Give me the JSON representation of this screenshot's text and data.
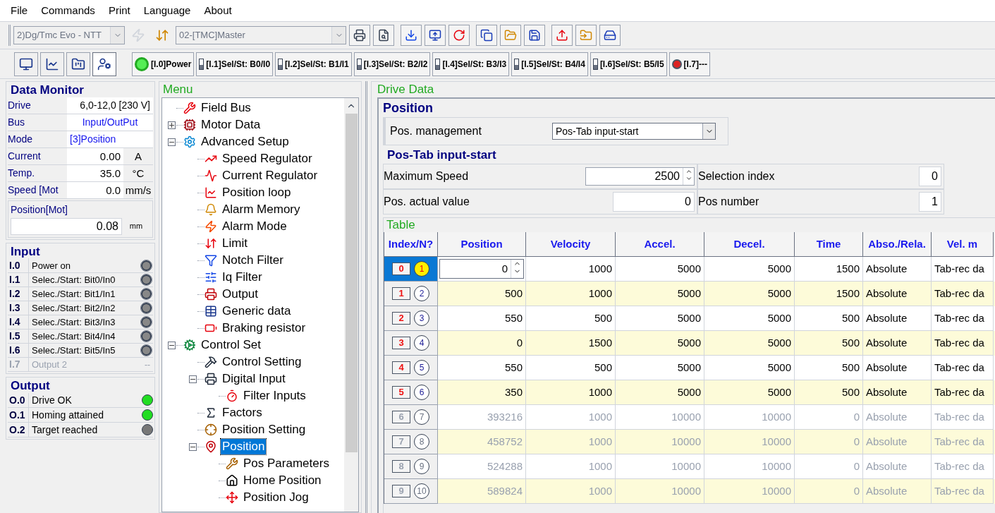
{
  "menu_bar": [
    "File",
    "Commands",
    "Print",
    "Language",
    "About"
  ],
  "toolbar": {
    "device_select": {
      "value": "2)Dg/Tmc Evo - NTT",
      "disabled": true
    },
    "node_select": {
      "value": "02-[TMC]Master",
      "disabled": true
    }
  },
  "view_buttons": [
    {
      "selected": false
    },
    {
      "selected": false
    },
    {
      "selected": false
    },
    {
      "selected": true
    }
  ],
  "io_strip": [
    {
      "kind": "power",
      "label": "[I.0]Power"
    },
    {
      "kind": "switch",
      "label": "[I.1]Sel/St: B0/I0"
    },
    {
      "kind": "switch",
      "label": "[I.2]Sel/St: B1/I1"
    },
    {
      "kind": "switch",
      "label": "[I.3]Sel/St: B2/I2"
    },
    {
      "kind": "switch",
      "label": "[I.4]Sel/St: B3/I3"
    },
    {
      "kind": "switch",
      "label": "[I.5]Sel/St: B4/I4"
    },
    {
      "kind": "switch",
      "label": "[I.6]Sel/St: B5/I5"
    },
    {
      "kind": "led",
      "label": "[I.7]---"
    }
  ],
  "data_monitor": {
    "title": "Data Monitor",
    "rows": [
      {
        "label": "Drive",
        "value": "6,0-12,0 [230 V]",
        "kind": "plain"
      },
      {
        "label": "Bus",
        "value": "Input/OutPut",
        "kind": "info"
      },
      {
        "label": "Mode",
        "value": "[3]Position",
        "kind": "mode"
      },
      {
        "label": "Current",
        "value": "0.00",
        "unit": "A",
        "kind": "unit"
      },
      {
        "label": "Temp.",
        "value": "35.0",
        "unit": "°C",
        "kind": "unit"
      },
      {
        "label": "Speed [Mot",
        "value": "0.0",
        "unit": "mm/s",
        "kind": "unit"
      }
    ],
    "position": {
      "title": "Position[Mot]",
      "value": "0.08",
      "unit": "mm"
    }
  },
  "input": {
    "title": "Input",
    "rows": [
      {
        "id": "I.0",
        "label": "Power on",
        "disabled": false
      },
      {
        "id": "I.1",
        "label": "Selec./Start: Bit0/In0",
        "disabled": false
      },
      {
        "id": "I.2",
        "label": "Selec./Start: Bit1/In1",
        "disabled": false
      },
      {
        "id": "I.3",
        "label": "Selec./Start: Bit2/In2",
        "disabled": false
      },
      {
        "id": "I.4",
        "label": "Selec./Start: Bit3/In3",
        "disabled": false
      },
      {
        "id": "I.5",
        "label": "Selec./Start: Bit4/In4",
        "disabled": false
      },
      {
        "id": "I.6",
        "label": "Selec./Start: Bit5/In5",
        "disabled": false
      },
      {
        "id": "I.7",
        "label": "Output 2",
        "disabled": true,
        "indicator": "--"
      }
    ]
  },
  "output": {
    "title": "Output",
    "rows": [
      {
        "id": "O.0",
        "label": "Drive OK",
        "on": true
      },
      {
        "id": "O.1",
        "label": "Homing attained",
        "on": true
      },
      {
        "id": "O.2",
        "label": "Target reached",
        "on": false
      }
    ]
  },
  "menu": {
    "title": "Menu",
    "items": [
      {
        "label": "Field Bus",
        "selected": false
      },
      {
        "label": "Motor Data",
        "selected": false,
        "expanded": false
      },
      {
        "label": "Advanced Setup",
        "selected": false,
        "expanded": true,
        "children": [
          {
            "label": "Speed Regulator",
            "selected": false
          },
          {
            "label": "Current Regulator",
            "selected": false
          },
          {
            "label": "Position loop",
            "selected": false
          },
          {
            "label": "Alarm Memory",
            "selected": false
          },
          {
            "label": "Alarm Mode",
            "selected": false
          },
          {
            "label": "Limit",
            "selected": false
          },
          {
            "label": "Notch Filter",
            "selected": false
          },
          {
            "label": "Iq Filter",
            "selected": false
          },
          {
            "label": "Output",
            "selected": false
          },
          {
            "label": "Generic data",
            "selected": false
          },
          {
            "label": "Braking resistor",
            "selected": false
          }
        ]
      },
      {
        "label": "Control Set",
        "selected": false,
        "expanded": true,
        "children": [
          {
            "label": "Control Setting",
            "selected": false
          },
          {
            "label": "Digital Input",
            "selected": false,
            "expanded": true,
            "children": [
              {
                "label": "Filter Inputs",
                "selected": false
              }
            ]
          },
          {
            "label": "Factors",
            "selected": false
          },
          {
            "label": "Position Setting",
            "selected": false
          },
          {
            "label": "Position",
            "selected": true,
            "expanded": true,
            "children": [
              {
                "label": "Pos Parameters",
                "selected": false
              },
              {
                "label": "Home Position",
                "selected": false
              },
              {
                "label": "Position Jog",
                "selected": false
              }
            ]
          }
        ]
      }
    ]
  },
  "drive_data": {
    "title": "Drive Data",
    "section": "Position",
    "pos_management": {
      "label": "Pos. management",
      "value": "Pos-Tab input-start"
    },
    "subsection": "Pos-Tab input-start",
    "fields": [
      {
        "label": "Maximum Speed",
        "value": "2500",
        "kind": "spin"
      },
      {
        "label": "Selection index",
        "value": "0",
        "kind": "small"
      },
      {
        "label": "Pos. actual value",
        "value": "0",
        "kind": "plain"
      },
      {
        "label": "Pos number",
        "value": "1",
        "kind": "small"
      }
    ],
    "table": {
      "title": "Table",
      "index_column": "Index/N?",
      "columns": [
        "Position",
        "Velocity",
        "Accel.",
        "Decel.",
        "Time",
        "Abso./Rela.",
        "Vel. m"
      ],
      "rows": [
        {
          "index": "0",
          "number": "1",
          "selected": true,
          "disabled": false,
          "cells": [
            "0",
            "1000",
            "5000",
            "5000",
            "1500",
            "Absolute",
            "Tab-rec da"
          ]
        },
        {
          "index": "1",
          "number": "2",
          "selected": false,
          "disabled": false,
          "cells": [
            "500",
            "1000",
            "5000",
            "5000",
            "1500",
            "Absolute",
            "Tab-rec da"
          ]
        },
        {
          "index": "2",
          "number": "3",
          "selected": false,
          "disabled": false,
          "cells": [
            "550",
            "500",
            "5000",
            "5000",
            "500",
            "Absolute",
            "Tab-rec da"
          ]
        },
        {
          "index": "3",
          "number": "4",
          "selected": false,
          "disabled": false,
          "cells": [
            "0",
            "1500",
            "5000",
            "5000",
            "500",
            "Absolute",
            "Tab-rec da"
          ]
        },
        {
          "index": "4",
          "number": "5",
          "selected": false,
          "disabled": false,
          "cells": [
            "550",
            "500",
            "5000",
            "5000",
            "500",
            "Absolute",
            "Tab-rec da"
          ]
        },
        {
          "index": "5",
          "number": "6",
          "selected": false,
          "disabled": false,
          "cells": [
            "350",
            "1000",
            "5000",
            "5000",
            "500",
            "Absolute",
            "Tab-rec da"
          ]
        },
        {
          "index": "6",
          "number": "7",
          "selected": false,
          "disabled": true,
          "cells": [
            "393216",
            "1000",
            "10000",
            "10000",
            "0",
            "Absolute",
            "Tab-rec da"
          ]
        },
        {
          "index": "7",
          "number": "8",
          "selected": false,
          "disabled": true,
          "cells": [
            "458752",
            "1000",
            "10000",
            "10000",
            "0",
            "Absolute",
            "Tab-rec da"
          ]
        },
        {
          "index": "8",
          "number": "9",
          "selected": false,
          "disabled": true,
          "cells": [
            "524288",
            "1000",
            "10000",
            "10000",
            "0",
            "Absolute",
            "Tab-rec da"
          ]
        },
        {
          "index": "9",
          "number": "10",
          "selected": false,
          "disabled": true,
          "cells": [
            "589824",
            "1000",
            "10000",
            "10000",
            "0",
            "Absolute",
            "Tab-rec da"
          ]
        }
      ]
    }
  }
}
